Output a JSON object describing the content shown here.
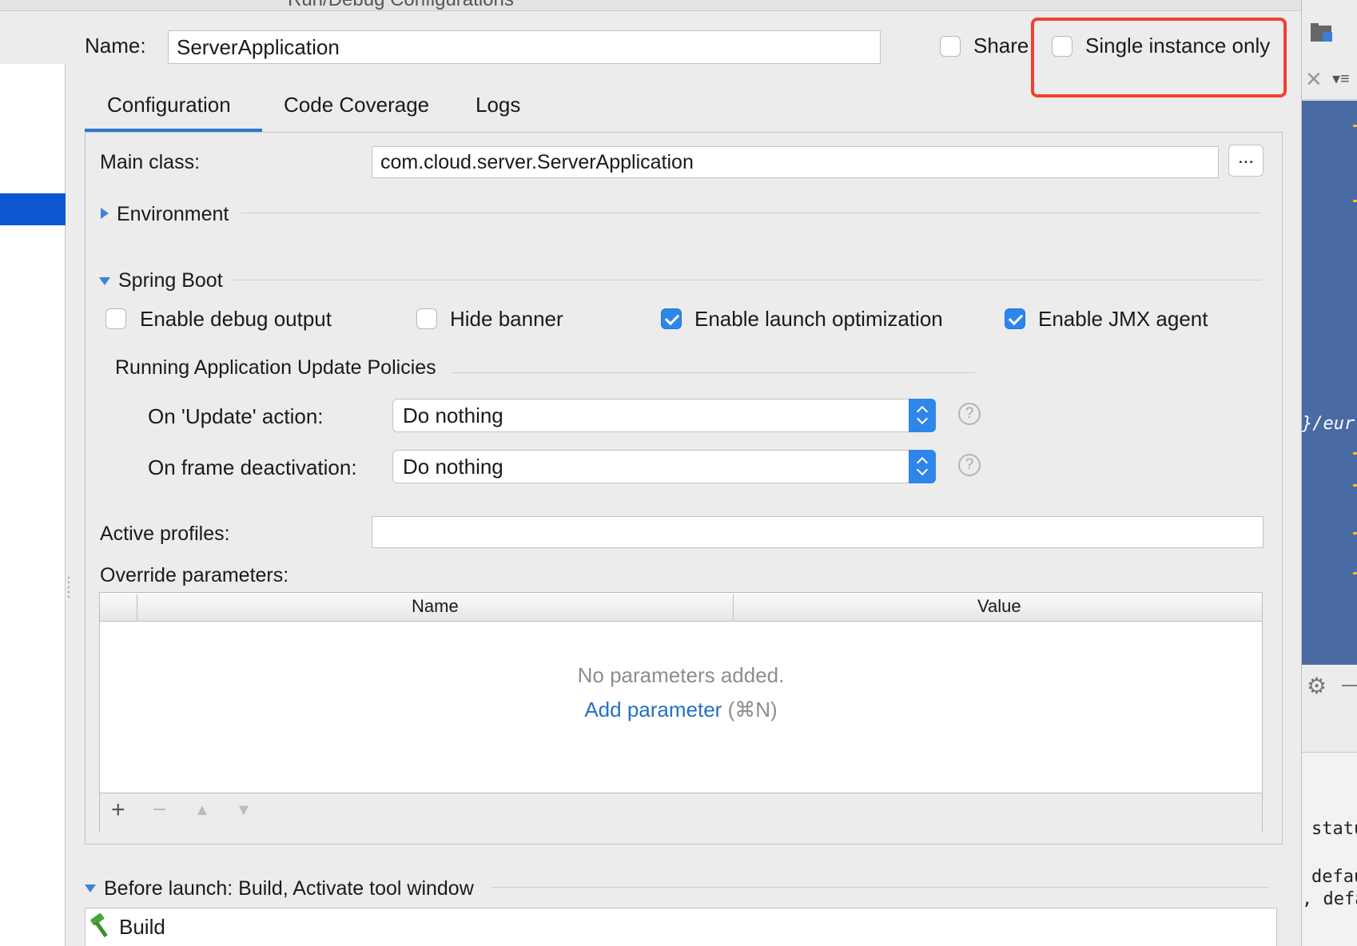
{
  "window": {
    "title": "Run/Debug Configurations"
  },
  "name_row": {
    "label": "Name:",
    "value": "ServerApplication",
    "share_label": "Share",
    "share_checked": false,
    "single_instance_label": "Single instance only",
    "single_instance_checked": false,
    "highlight_color": "#f1402f"
  },
  "tabs": [
    {
      "label": "Configuration",
      "active": true
    },
    {
      "label": "Code Coverage",
      "active": false
    },
    {
      "label": "Logs",
      "active": false
    }
  ],
  "main_class": {
    "label": "Main class:",
    "value": "com.cloud.server.ServerApplication",
    "browse_label": "..."
  },
  "environment": {
    "label": "Environment",
    "expanded": false
  },
  "spring_boot": {
    "label": "Spring Boot",
    "expanded": true,
    "options": [
      {
        "label": "Enable debug output",
        "checked": false
      },
      {
        "label": "Hide banner",
        "checked": false
      },
      {
        "label": "Enable launch optimization",
        "checked": true
      },
      {
        "label": "Enable JMX agent",
        "checked": true
      }
    ]
  },
  "update_policies": {
    "heading": "Running Application Update Policies",
    "on_update": {
      "label": "On 'Update' action:",
      "value": "Do nothing"
    },
    "on_frame_deactivation": {
      "label": "On frame deactivation:",
      "value": "Do nothing"
    },
    "help_glyph": "?"
  },
  "active_profiles": {
    "label": "Active profiles:",
    "value": ""
  },
  "override_parameters": {
    "label": "Override parameters:",
    "columns": [
      "Name",
      "Value"
    ],
    "empty_message": "No parameters added.",
    "add_link": "Add parameter",
    "add_shortcut": "(⌘N)",
    "toolbar": {
      "add": "+",
      "remove": "−",
      "up": "▲",
      "down": "▼"
    }
  },
  "before_launch": {
    "label": "Before launch: Build, Activate tool window",
    "items": [
      {
        "label": "Build",
        "icon": "hammer-icon"
      }
    ]
  },
  "editor_snippets": {
    "url_fragment": "}/eur",
    "line1": "statu",
    "line2": "defau",
    "line3": ", defa"
  },
  "colors": {
    "accent": "#2e86ea",
    "selection": "#0d58d1",
    "link": "#2470c2",
    "editor_bg": "#4a6aa3"
  }
}
